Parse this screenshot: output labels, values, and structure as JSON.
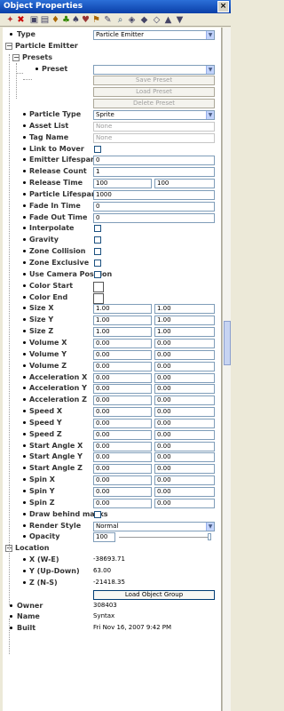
{
  "window": {
    "title": "Object Properties",
    "close_glyph": "×"
  },
  "toolbar": {
    "icons": [
      "unknown-icon",
      "delete-icon",
      "unknown-icon",
      "unknown-icon",
      "unknown-icon",
      "unknown-icon",
      "unknown-icon",
      "unknown-icon",
      "unknown-icon",
      "unknown-icon",
      "unknown-icon",
      "unknown-icon",
      "unknown-icon",
      "unknown-icon",
      "unknown-icon",
      "unknown-icon"
    ]
  },
  "type_row": {
    "label": "Type",
    "value": "Particle Emitter"
  },
  "particle_emitter": {
    "label": "Particle Emitter",
    "expander": "−"
  },
  "presets": {
    "label": "Presets",
    "expander": "−",
    "preset_label": "Preset",
    "preset_value": "",
    "save_label": "Save Preset",
    "load_label": "Load Preset",
    "delete_label": "Delete Preset"
  },
  "props": {
    "particle_type": {
      "label": "Particle Type",
      "value": "Sprite"
    },
    "asset_list": {
      "label": "Asset List",
      "value": "None"
    },
    "tag_name": {
      "label": "Tag Name",
      "value": "None"
    },
    "link_to_mover": {
      "label": "Link to Mover"
    },
    "emitter_lifespan": {
      "label": "Emitter Lifespan",
      "value": "0"
    },
    "release_count": {
      "label": "Release Count",
      "value": "1"
    },
    "release_time": {
      "label": "Release Time",
      "value_a": "100",
      "value_b": "100"
    },
    "particle_lifespan": {
      "label": "Particle Lifespan",
      "value": "1000"
    },
    "fade_in_time": {
      "label": "Fade In Time",
      "value": "0"
    },
    "fade_out_time": {
      "label": "Fade Out Time",
      "value": "0"
    },
    "interpolate": {
      "label": "Interpolate"
    },
    "gravity": {
      "label": "Gravity"
    },
    "zone_collision": {
      "label": "Zone Collision"
    },
    "zone_exclusive": {
      "label": "Zone Exclusive"
    },
    "use_camera_position": {
      "label": "Use Camera Position"
    },
    "color_start": {
      "label": "Color Start",
      "color": "#ffffff"
    },
    "color_end": {
      "label": "Color End",
      "color": "#ffffff"
    },
    "size_x": {
      "label": "Size X",
      "value_a": "1.00",
      "value_b": "1.00"
    },
    "size_y": {
      "label": "Size Y",
      "value_a": "1.00",
      "value_b": "1.00"
    },
    "size_z": {
      "label": "Size Z",
      "value_a": "1.00",
      "value_b": "1.00"
    },
    "volume_x": {
      "label": "Volume X",
      "value_a": "0.00",
      "value_b": "0.00"
    },
    "volume_y": {
      "label": "Volume Y",
      "value_a": "0.00",
      "value_b": "0.00"
    },
    "volume_z": {
      "label": "Volume Z",
      "value_a": "0.00",
      "value_b": "0.00"
    },
    "acceleration_x": {
      "label": "Acceleration X",
      "value_a": "0.00",
      "value_b": "0.00"
    },
    "acceleration_y": {
      "label": "Acceleration Y",
      "value_a": "0.00",
      "value_b": "0.00"
    },
    "acceleration_z": {
      "label": "Acceleration Z",
      "value_a": "0.00",
      "value_b": "0.00"
    },
    "speed_x": {
      "label": "Speed X",
      "value_a": "0.00",
      "value_b": "0.00"
    },
    "speed_y": {
      "label": "Speed Y",
      "value_a": "0.00",
      "value_b": "0.00"
    },
    "speed_z": {
      "label": "Speed Z",
      "value_a": "0.00",
      "value_b": "0.00"
    },
    "start_angle_x": {
      "label": "Start Angle X",
      "value_a": "0.00",
      "value_b": "0.00"
    },
    "start_angle_y": {
      "label": "Start Angle Y",
      "value_a": "0.00",
      "value_b": "0.00"
    },
    "start_angle_z": {
      "label": "Start Angle Z",
      "value_a": "0.00",
      "value_b": "0.00"
    },
    "spin_x": {
      "label": "Spin X",
      "value_a": "0.00",
      "value_b": "0.00"
    },
    "spin_y": {
      "label": "Spin Y",
      "value_a": "0.00",
      "value_b": "0.00"
    },
    "spin_z": {
      "label": "Spin Z",
      "value_a": "0.00",
      "value_b": "0.00"
    },
    "draw_behind_masks": {
      "label": "Draw behind masks"
    },
    "render_style": {
      "label": "Render Style",
      "value": "Normal"
    },
    "opacity": {
      "label": "Opacity",
      "value": "100",
      "level_percent": 100
    }
  },
  "location": {
    "label": "Location",
    "expander": "−",
    "x": {
      "label": "X (W-E)",
      "value": "-38693.71"
    },
    "y": {
      "label": "Y (Up-Down)",
      "value": "63.00"
    },
    "z": {
      "label": "Z (N-S)",
      "value": "-21418.35"
    },
    "load_group_label": "Load Object Group"
  },
  "owner": {
    "label": "Owner",
    "value": "308403"
  },
  "name": {
    "label": "Name",
    "value": "Syntax"
  },
  "built": {
    "label": "Built",
    "value": "Fri Nov 16, 2007 9:42 PM"
  }
}
